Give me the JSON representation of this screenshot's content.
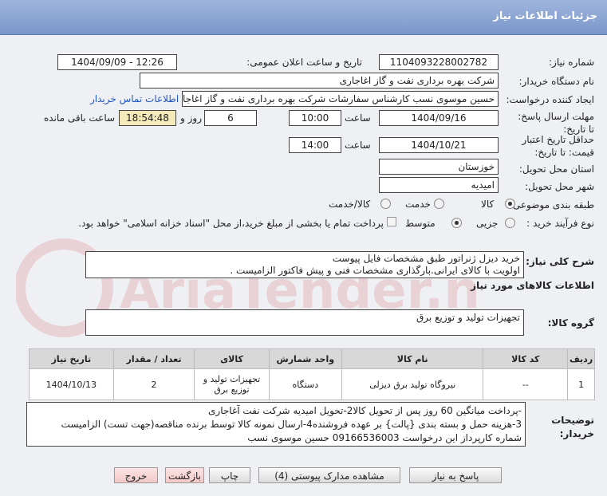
{
  "page_title": "جزئیات اطلاعات نیاز",
  "labels": {
    "need_number": "شماره نیاز:",
    "announce_datetime": "تاریخ و ساعت اعلان عمومی:",
    "buyer_org": "نام دستگاه خریدار:",
    "requester": "ایجاد کننده درخواست:",
    "reply_deadline": "مهلت ارسال پاسخ: تا تاریخ:",
    "time": "ساعت",
    "and_day": "روز و",
    "remaining": "ساعت باقی مانده",
    "min_price_validity": "حداقل تاریخ اعتبار قیمت: تا تاریخ:",
    "delivery_province": "استان محل تحویل:",
    "delivery_city": "شهر محل تحویل:",
    "subject_class": "طبقه بندی موضوعی:",
    "purchase_type": "نوع فرآیند خرید :",
    "need_description": "شرح کلی نیاز:",
    "goods_info": "اطلاعات کالاهای مورد نیاز",
    "goods_group": "گروه کالا:",
    "buyer_notes": "توضیحات خریدار:"
  },
  "values": {
    "need_number": "1104093228002782",
    "announce_datetime": "1404/09/09 - 12:26",
    "buyer_org": "شرکت بهره برداری نفت و گاز اغاجاری",
    "requester": "حسین موسوی نسب کارشناس سفارشات شرکت بهره برداری نفت و گاز اغاجار",
    "contact_link": "اطلاعات تماس خریدار",
    "reply_date": "1404/09/16",
    "reply_time": "10:00",
    "days": "6",
    "remaining_time": "18:54:48",
    "validity_date": "1404/10/21",
    "validity_time": "14:00",
    "province": "خوزستان",
    "city": "امیدیه",
    "subject_options": [
      "کالا",
      "خدمت",
      "کالا/خدمت"
    ],
    "subject_selected": "کالا",
    "purchase_options": [
      "جزیی",
      "متوسط"
    ],
    "purchase_selected": "متوسط",
    "payment_note": "پرداخت تمام یا بخشی از مبلغ خرید،از محل \"اسناد خزانه اسلامی\" خواهد بود.",
    "need_description_line1": "خرید دیزل ژنراتور  طبق مشخصات فایل پیوست",
    "need_description_line2": "اولویت با کالای ایرانی.بارگذاری مشخصات فنی و پیش فاکتور الزامیست .",
    "goods_group": "تجهیزات تولید و توزیع برق",
    "buyer_notes_line1": "-پرداخت میانگین 60 روز پس از تحویل کالا2-تحویل امیدیه شرکت نفت آغاجاری",
    "buyer_notes_line2": "3-هزینه حمل  و بسته بندی {پالت} بر عهده فروشنده4-ارسال نمونه کالا توسط برنده مناقصه(جهت تست) الزامیست",
    "buyer_notes_line3": "شماره کارپرداز این درخواست 09166536003 حسین موسوی نسب"
  },
  "table": {
    "headers": [
      "ردیف",
      "کد کالا",
      "نام کالا",
      "واحد شمارش",
      "کالای",
      "تعداد / مقدار",
      "تاریخ نیاز"
    ],
    "rows": [
      [
        "1",
        "--",
        "نیروگاه تولید برق دیزلی",
        "دستگاه",
        "تجهیزات تولید و توزیع برق",
        "2",
        "1404/10/13"
      ]
    ]
  },
  "buttons": {
    "reply": "پاسخ به نیاز",
    "view_docs": "مشاهده مدارک پیوستی (4)",
    "print": "چاپ",
    "back": "بازگشت",
    "exit": "خروج"
  },
  "watermark": "AriaTender.neT",
  "colors": {
    "title_bar": "#8aa3d3",
    "link": "#1f56c7",
    "remaining_bg": "#f4e9b8"
  }
}
